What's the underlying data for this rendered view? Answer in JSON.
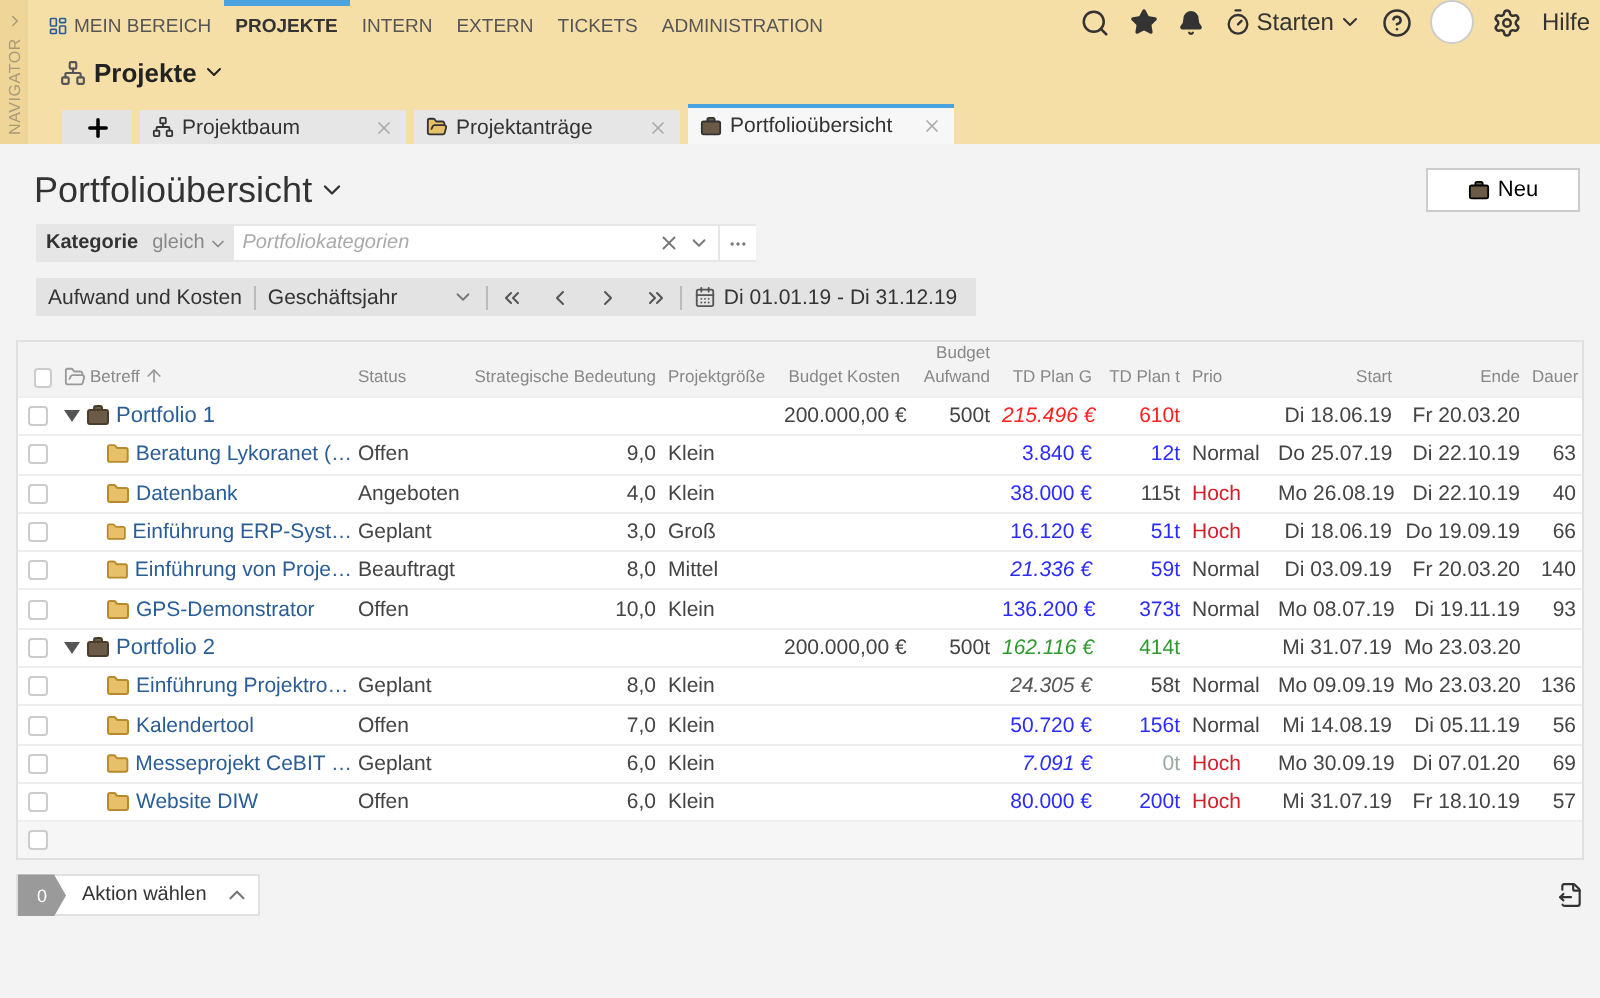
{
  "navigator": {
    "label": "NAVIGATOR"
  },
  "nav": [
    {
      "label": "MEIN BEREICH",
      "selected": false
    },
    {
      "label": "PROJEKTE",
      "selected": true
    },
    {
      "label": "INTERN",
      "selected": false
    },
    {
      "label": "EXTERN",
      "selected": false
    },
    {
      "label": "TICKETS",
      "selected": false
    },
    {
      "label": "ADMINISTRATION",
      "selected": false
    }
  ],
  "top_actions": {
    "start": "Starten",
    "help": "Hilfe"
  },
  "module": {
    "title": "Projekte"
  },
  "tabs": [
    {
      "label": "Projektbaum",
      "selected": false
    },
    {
      "label": "Projektanträge",
      "selected": false
    },
    {
      "label": "Portfolioübersicht",
      "selected": true
    }
  ],
  "page": {
    "title": "Portfolioübersicht",
    "new_button": "Neu"
  },
  "filter": {
    "field": "Kategorie",
    "operator": "gleich",
    "placeholder": "Portfoliokategorien"
  },
  "toolbar": {
    "view": "Aufwand und Kosten",
    "period": "Geschäftsjahr",
    "range": "Di 01.01.19 - Di 31.12.19"
  },
  "table": {
    "header_checked": false,
    "blank_row_checked": false,
    "columns": [
      {
        "label": "Betreff"
      },
      {
        "label": "Status"
      },
      {
        "label": "Strategische Bedeutung"
      },
      {
        "label": "Projektgröße"
      },
      {
        "label": "Budget Kosten"
      },
      {
        "label": "Budget Aufwand"
      },
      {
        "label": "TD Plan G"
      },
      {
        "label": "TD Plan t"
      },
      {
        "label": "Prio"
      },
      {
        "label": "Start"
      },
      {
        "label": "Ende"
      },
      {
        "label": "Dauer"
      }
    ],
    "rows": [
      {
        "kind": "group",
        "title": "Portfolio 1",
        "expanded": true,
        "checked": false,
        "budget_costs": "200.000,00 €",
        "budget_effort": "500t",
        "td_plan_g": {
          "text": "215.496 €",
          "color": "#ff2020",
          "italic": true
        },
        "td_plan_t": {
          "text": "610t",
          "color": "#ff2020"
        },
        "start": "Di 18.06.19",
        "end": "Fr 20.03.20",
        "children": [
          {
            "kind": "project",
            "title": "Beratung Lykoranet (…",
            "checked": false,
            "status": "Offen",
            "importance": "9,0",
            "size": "Klein",
            "td_plan_g": {
              "text": "3.840 €",
              "color": "#2b2bff",
              "italic": false
            },
            "td_plan_t": {
              "text": "12t",
              "color": "#2b2bff"
            },
            "prio": {
              "text": "Normal",
              "color": "#444444"
            },
            "start": "Do 25.07.19",
            "end": "Di 22.10.19",
            "duration": "63"
          },
          {
            "kind": "project",
            "title": "Datenbank",
            "checked": false,
            "status": "Angeboten",
            "importance": "4,0",
            "size": "Klein",
            "td_plan_g": {
              "text": "38.000 €",
              "color": "#2b2bff",
              "italic": false
            },
            "td_plan_t": {
              "text": "115t",
              "color": "#444444"
            },
            "prio": {
              "text": "Hoch",
              "color": "#d0202a"
            },
            "start": "Mo 26.08.19",
            "end": "Di 22.10.19",
            "duration": "40"
          },
          {
            "kind": "project",
            "title": "Einführung ERP-Syst…",
            "checked": false,
            "status": "Geplant",
            "importance": "3,0",
            "size": "Groß",
            "td_plan_g": {
              "text": "16.120 €",
              "color": "#2b2bff",
              "italic": false
            },
            "td_plan_t": {
              "text": "51t",
              "color": "#2b2bff"
            },
            "prio": {
              "text": "Hoch",
              "color": "#d0202a"
            },
            "start": "Di 18.06.19",
            "end": "Do 19.09.19",
            "duration": "66"
          },
          {
            "kind": "project",
            "title": "Einführung von Proje…",
            "checked": false,
            "status": "Beauftragt",
            "importance": "8,0",
            "size": "Mittel",
            "td_plan_g": {
              "text": "21.336 €",
              "color": "#2b2bff",
              "italic": true
            },
            "td_plan_t": {
              "text": "59t",
              "color": "#2b2bff"
            },
            "prio": {
              "text": "Normal",
              "color": "#444444"
            },
            "start": "Di 03.09.19",
            "end": "Fr 20.03.20",
            "duration": "140"
          },
          {
            "kind": "project",
            "title": "GPS-Demonstrator",
            "checked": false,
            "status": "Offen",
            "importance": "10,0",
            "size": "Klein",
            "td_plan_g": {
              "text": "136.200 €",
              "color": "#2b2bff",
              "italic": false
            },
            "td_plan_t": {
              "text": "373t",
              "color": "#2b2bff"
            },
            "prio": {
              "text": "Normal",
              "color": "#444444"
            },
            "start": "Mo 08.07.19",
            "end": "Di 19.11.19",
            "duration": "93"
          }
        ]
      },
      {
        "kind": "group",
        "title": "Portfolio 2",
        "expanded": true,
        "checked": false,
        "budget_costs": "200.000,00 €",
        "budget_effort": "500t",
        "td_plan_g": {
          "text": "162.116 €",
          "color": "#2e9a2e",
          "italic": true
        },
        "td_plan_t": {
          "text": "414t",
          "color": "#2e9a2e"
        },
        "start": "Mi 31.07.19",
        "end": "Mo 23.03.20",
        "children": [
          {
            "kind": "project",
            "title": "Einführung Projektro…",
            "checked": false,
            "status": "Geplant",
            "importance": "8,0",
            "size": "Klein",
            "td_plan_g": {
              "text": "24.305 €",
              "color": "#555555",
              "italic": true
            },
            "td_plan_t": {
              "text": "58t",
              "color": "#444444"
            },
            "prio": {
              "text": "Normal",
              "color": "#444444"
            },
            "start": "Mo 09.09.19",
            "end": "Mo 23.03.20",
            "duration": "136"
          },
          {
            "kind": "project",
            "title": "Kalendertool",
            "checked": false,
            "status": "Offen",
            "importance": "7,0",
            "size": "Klein",
            "td_plan_g": {
              "text": "50.720 €",
              "color": "#2b2bff",
              "italic": false
            },
            "td_plan_t": {
              "text": "156t",
              "color": "#2b2bff"
            },
            "prio": {
              "text": "Normal",
              "color": "#444444"
            },
            "start": "Mi 14.08.19",
            "end": "Di 05.11.19",
            "duration": "56"
          },
          {
            "kind": "project",
            "title": "Messeprojekt CeBIT …",
            "checked": false,
            "status": "Geplant",
            "importance": "6,0",
            "size": "Klein",
            "td_plan_g": {
              "text": "7.091 €",
              "color": "#2b2bff",
              "italic": true
            },
            "td_plan_t": {
              "text": "0t",
              "color": "#98aaa0"
            },
            "prio": {
              "text": "Hoch",
              "color": "#d0202a"
            },
            "start": "Mo 30.09.19",
            "end": "Di 07.01.20",
            "duration": "69"
          },
          {
            "kind": "project",
            "title": "Website DIW",
            "checked": false,
            "status": "Offen",
            "importance": "6,0",
            "size": "Klein",
            "td_plan_g": {
              "text": "80.000 €",
              "color": "#2b2bff",
              "italic": false
            },
            "td_plan_t": {
              "text": "200t",
              "color": "#2b2bff"
            },
            "prio": {
              "text": "Hoch",
              "color": "#d0202a"
            },
            "start": "Mi 31.07.19",
            "end": "Fr 18.10.19",
            "duration": "57"
          }
        ]
      }
    ]
  },
  "footer": {
    "count": "0",
    "action": "Aktion wählen"
  }
}
